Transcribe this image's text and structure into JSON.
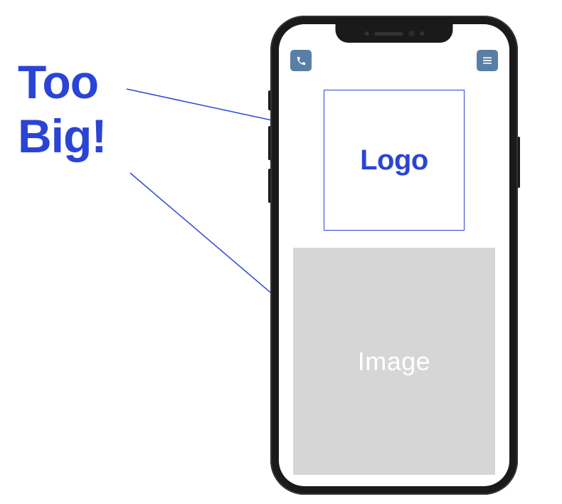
{
  "annotation": {
    "line1": "Too",
    "line2": "Big!"
  },
  "phone": {
    "header": {
      "phone_icon": "phone",
      "menu_icon": "menu"
    },
    "logo": {
      "label": "Logo"
    },
    "image_placeholder": {
      "label": "Image"
    }
  }
}
